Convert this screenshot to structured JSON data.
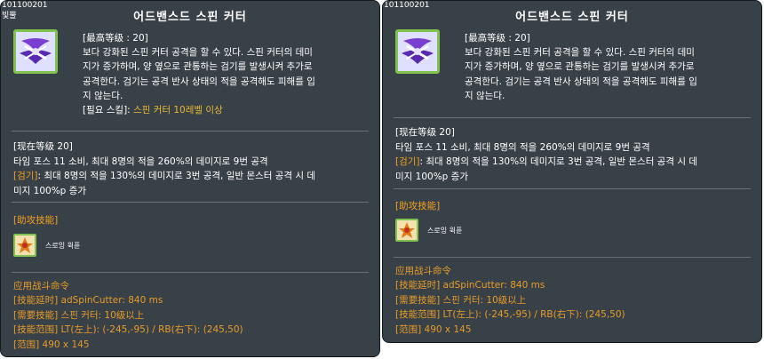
{
  "tooltips": [
    {
      "id_line": "101100201",
      "id_line2": "빛뿔",
      "title": "어드밴스드 스핀 커터",
      "master_level": "[最高等级 : 20]",
      "desc_lines": [
        "보다 강화된 스핀 커터 공격을 할 수 있다. 스핀 커터의 데미",
        "지가 증가하며, 양 옆으로 관통하는 검기를 발생시켜 추가로",
        "공격한다. 검기는 공격 반사 상태의 적을 공격해도 피해를 입",
        "지 않는다."
      ],
      "required_prefix": "[필요 스킬]: ",
      "required_value": "스핀 커터 10레벨 이상",
      "current_level": "[现在等级 20]",
      "current_line1": "타임 포스 11 소비, 최대 8명의 적을 260%의 데미지로 9번 공격",
      "current_line2_prefix": "[검기]",
      "current_line2_text": ": 최대 8명의 적을 130%의 데미지로 3번 공격, 일반 몬스터 공격 시 데",
      "current_line3": "미지 100%p 증가",
      "support_head": "[助攻技能]",
      "support_label": "스로잉 윅퓬",
      "cmd_head": "应用战斗命令",
      "cmd_lines": [
        "[技能延时] adSpinCutter: 840 ms",
        "[需要技能] 스핀 커터: 10级以上",
        "[技能范围] LT(左上): (-245,-95) / RB(右下): (245,50)",
        "[范围] 490 x 145"
      ]
    },
    {
      "id_line": "101100201",
      "title": "어드밴스드 스핀 커터",
      "master_level": "[最高等级 : 20]",
      "desc_lines": [
        "보다 강화된 스핀 커터 공격을 할 수 있다. 스핀 커터의 데미",
        "지가 증가하며, 양 옆으로 관통하는 검기를 발생시켜 추가로",
        "공격한다. 검기는 공격 반사 상태의 적을 공격해도 피해를 입",
        "지 않는다."
      ],
      "current_level": "[现在等级 20]",
      "current_line1": "타임 포스 11 소비, 최대 8명의 적을 260%의 데미지로 9번 공격",
      "current_line2_prefix": "[검기]",
      "current_line2_text": ": 최대 8명의 적을 130%의 데미지로 3번 공격, 일반 몬스터 공격 시 데",
      "current_line3": "미지 100%p 증가",
      "support_head": "[助攻技能]",
      "support_label": "스로잉 윅퓬",
      "cmd_head": "应用战斗命令",
      "cmd_lines": [
        "[技能延时] adSpinCutter: 840 ms",
        "[需要技能] 스핀 커터: 10级以上",
        "[技能范围] LT(左上): (-245,-95) / RB(右下): (245,50)",
        "[范围] 490 x 145"
      ]
    }
  ],
  "icon_names": [
    "skill-icon-spin-cutter",
    "support-skill-icon-throwing"
  ],
  "colors": {
    "panel_bg": "#384048",
    "accent_yellow": "#e8b830",
    "accent_orange": "#f0a020",
    "icon_border": "#7fc24e"
  }
}
